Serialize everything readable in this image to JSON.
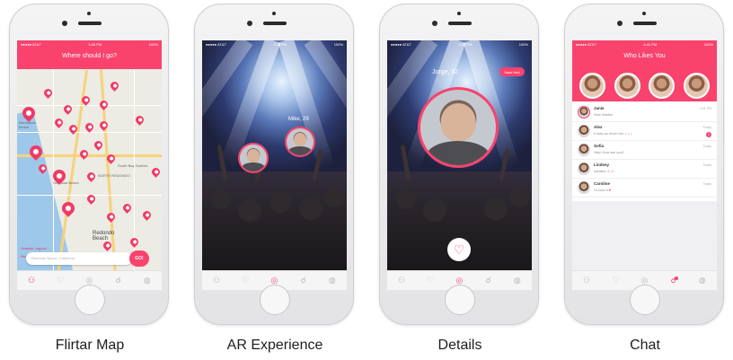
{
  "colors": {
    "accent": "#f9436d",
    "map_water": "#9ec8ea",
    "map_land": "#ecebe4"
  },
  "phones": [
    {
      "caption": "Flirtar Map",
      "status": {
        "carrier": "●●●●● AT&T",
        "time": "3:28 PM",
        "battery": "100%"
      },
      "header_title": "Where should I go?",
      "map_labels": {
        "manhattan": "Manhattan Beach",
        "hermosa": "Hermosa Beach",
        "redondo": "Redondo Beach",
        "south_bay": "South Bay Galleria",
        "north_redondo": "NORTH REDONDO",
        "seaside": "Seaside Lagoon",
        "redondo_pier": "Redondo Beach Pier"
      },
      "search_placeholder": "Redondo Beach, California",
      "go_label": "GO!"
    },
    {
      "caption": "AR Experience",
      "status": {
        "carrier": "●●●●● AT&T",
        "time": "3:28 PM",
        "battery": "100%"
      },
      "profile_name": "Mike, 29"
    },
    {
      "caption": "Details",
      "status": {
        "carrier": "●●●●● AT&T",
        "time": "3:28 PM",
        "battery": "100%"
      },
      "profile_name": "Jorge, 32",
      "save_label": "Save him!"
    },
    {
      "caption": "Chat",
      "status": {
        "carrier": "●●●●● AT&T",
        "time": "4:41 PM",
        "battery": "100%"
      },
      "header_title": "Who Likes You",
      "chats": [
        {
          "name": "Janie",
          "message": "Nice Martini",
          "emoji": "",
          "time": "4:41 PM",
          "badge": ""
        },
        {
          "name": "Alex",
          "message": "It was so much fun",
          "emoji": "♪ ♪ ♪",
          "time": "Today",
          "badge": "1"
        },
        {
          "name": "Sofia",
          "message": "Hey! How are you?",
          "emoji": "",
          "time": "Today",
          "badge": ""
        },
        {
          "name": "Lindsey",
          "message": "hahaha",
          "emoji": "☺☺",
          "time": "Today",
          "badge": ""
        },
        {
          "name": "Caroline",
          "message": "I'd love it",
          "emoji": "♥",
          "time": "Today",
          "badge": ""
        }
      ]
    }
  ],
  "tabs": [
    "user-icon",
    "hearts-icon",
    "camera-icon",
    "thumbs-icon",
    "chat-icon"
  ]
}
